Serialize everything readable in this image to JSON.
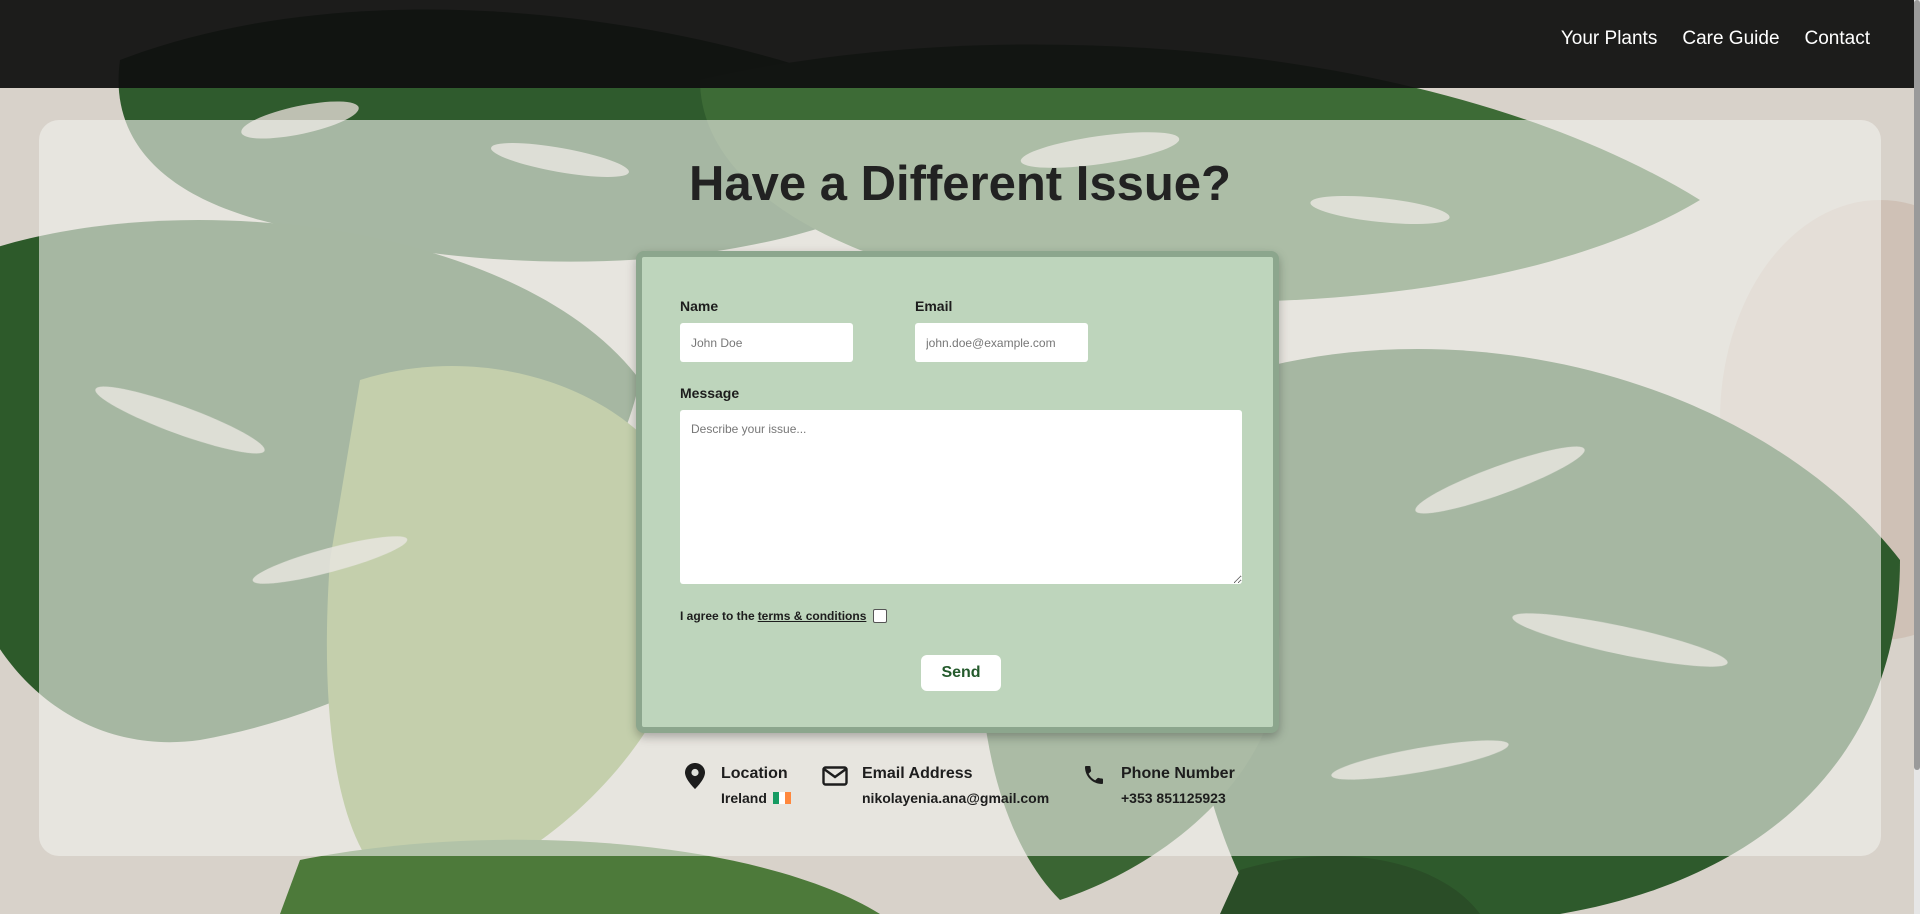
{
  "nav": {
    "links": [
      "Your Plants",
      "Care Guide",
      "Contact"
    ]
  },
  "page": {
    "title": "Have a Different Issue?"
  },
  "form": {
    "name_label": "Name",
    "name_placeholder": "John Doe",
    "email_label": "Email",
    "email_placeholder": "john.doe@example.com",
    "message_label": "Message",
    "message_placeholder": "Describe your issue...",
    "terms_prefix": "I agree to the",
    "terms_link": "terms & conditions",
    "terms_checked": false,
    "send_label": "Send"
  },
  "contact": {
    "location_title": "Location",
    "location_value": "Ireland",
    "email_title": "Email Address",
    "email_value": "nikolayenia.ana@gmail.com",
    "phone_title": "Phone Number",
    "phone_value": "+353 851125923"
  },
  "icons": {
    "location": "map-pin-icon",
    "email": "envelope-icon",
    "phone": "phone-icon",
    "flag": "ireland-flag-icon"
  },
  "colors": {
    "navbar": "#101010",
    "form_background": "#bed5bc",
    "form_border": "#8ca68d",
    "send_text": "#245a2c",
    "flag_green": "#169b62",
    "flag_white": "#ffffff",
    "flag_orange": "#ff883e"
  }
}
